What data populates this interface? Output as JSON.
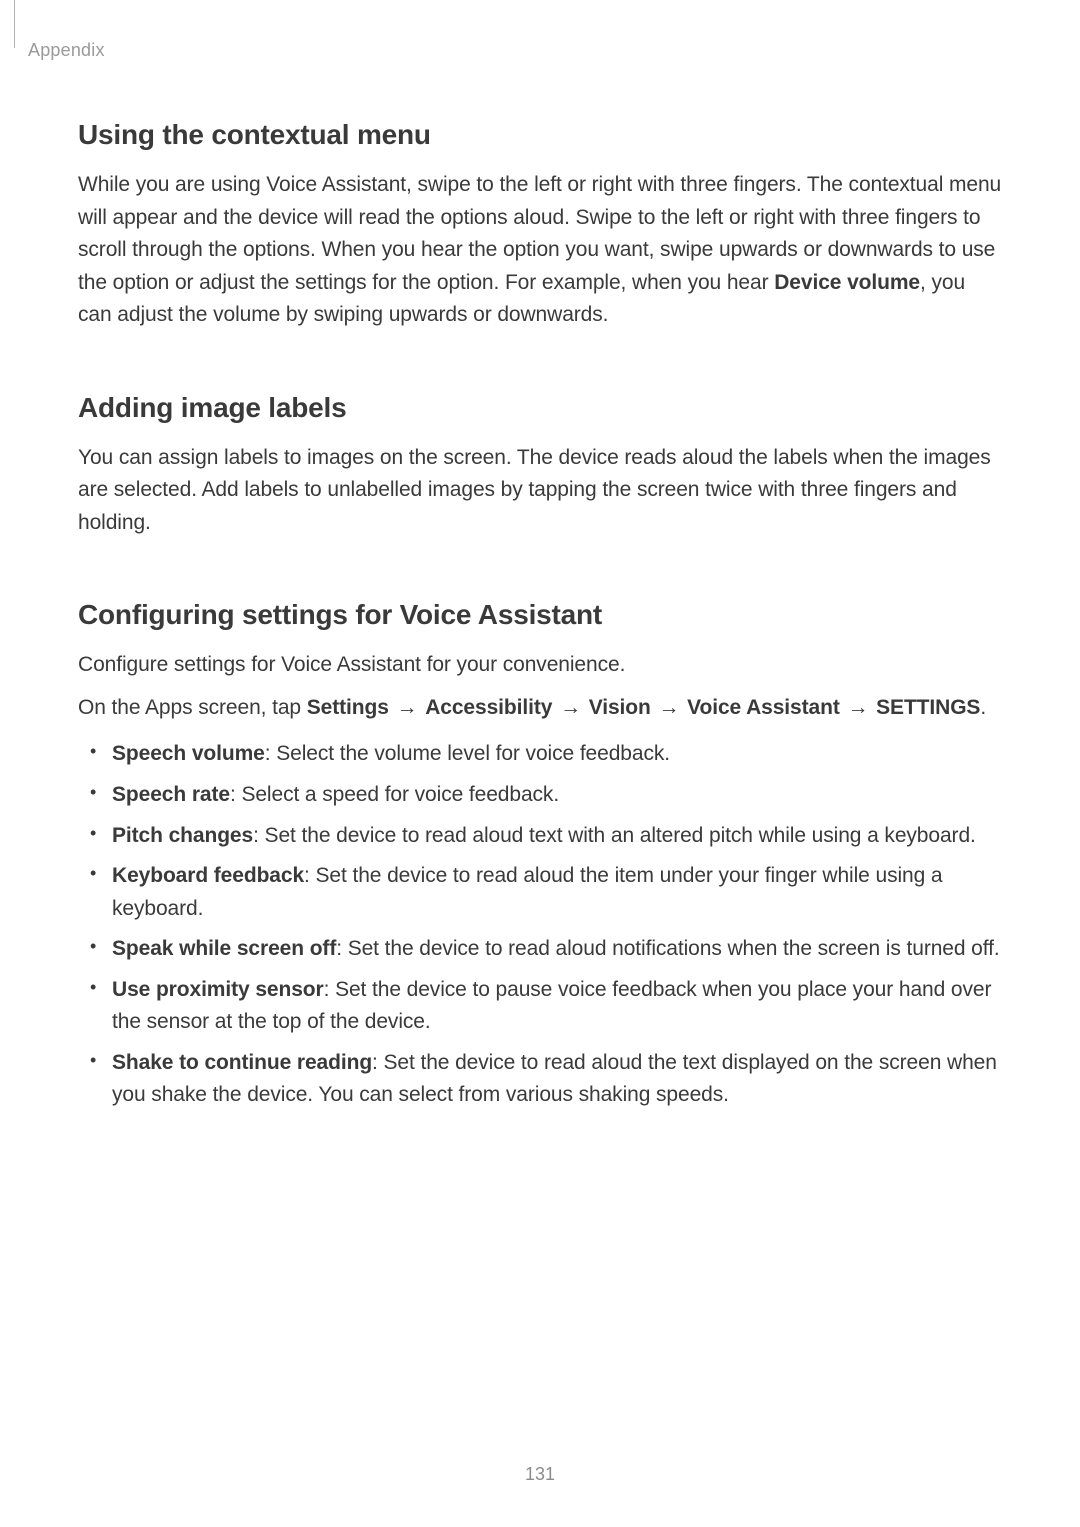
{
  "section_label": "Appendix",
  "page_number": "131",
  "arrow": "→",
  "h1": "Using the contextual menu",
  "p1a": "While you are using Voice Assistant, swipe to the left or right with three fingers. The contextual menu will appear and the device will read the options aloud. Swipe to the left or right with three fingers to scroll through the options. When you hear the option you want, swipe upwards or downwards to use the option or adjust the settings for the option. For example, when you hear ",
  "p1b_bold": "Device volume",
  "p1c": ", you can adjust the volume by swiping upwards or downwards.",
  "h2": "Adding image labels",
  "p2": "You can assign labels to images on the screen. The device reads aloud the labels when the images are selected. Add labels to unlabelled images by tapping the screen twice with three fingers and holding.",
  "h3": "Configuring settings for Voice Assistant",
  "p3": "Configure settings for Voice Assistant for your convenience.",
  "p4_pre": "On the Apps screen, tap ",
  "p4_s1": "Settings",
  "p4_s2": "Accessibility",
  "p4_s3": "Vision",
  "p4_s4": "Voice Assistant",
  "p4_s5": "SETTINGS",
  "p4_post": ".",
  "bullets": [
    {
      "term": "Speech volume",
      "desc": ": Select the volume level for voice feedback."
    },
    {
      "term": "Speech rate",
      "desc": ": Select a speed for voice feedback."
    },
    {
      "term": "Pitch changes",
      "desc": ": Set the device to read aloud text with an altered pitch while using a keyboard."
    },
    {
      "term": "Keyboard feedback",
      "desc": ": Set the device to read aloud the item under your finger while using a keyboard."
    },
    {
      "term": "Speak while screen off",
      "desc": ": Set the device to read aloud notifications when the screen is turned off."
    },
    {
      "term": "Use proximity sensor",
      "desc": ": Set the device to pause voice feedback when you place your hand over the sensor at the top of the device."
    },
    {
      "term": "Shake to continue reading",
      "desc": ": Set the device to read aloud the text displayed on the screen when you shake the device. You can select from various shaking speeds."
    }
  ]
}
